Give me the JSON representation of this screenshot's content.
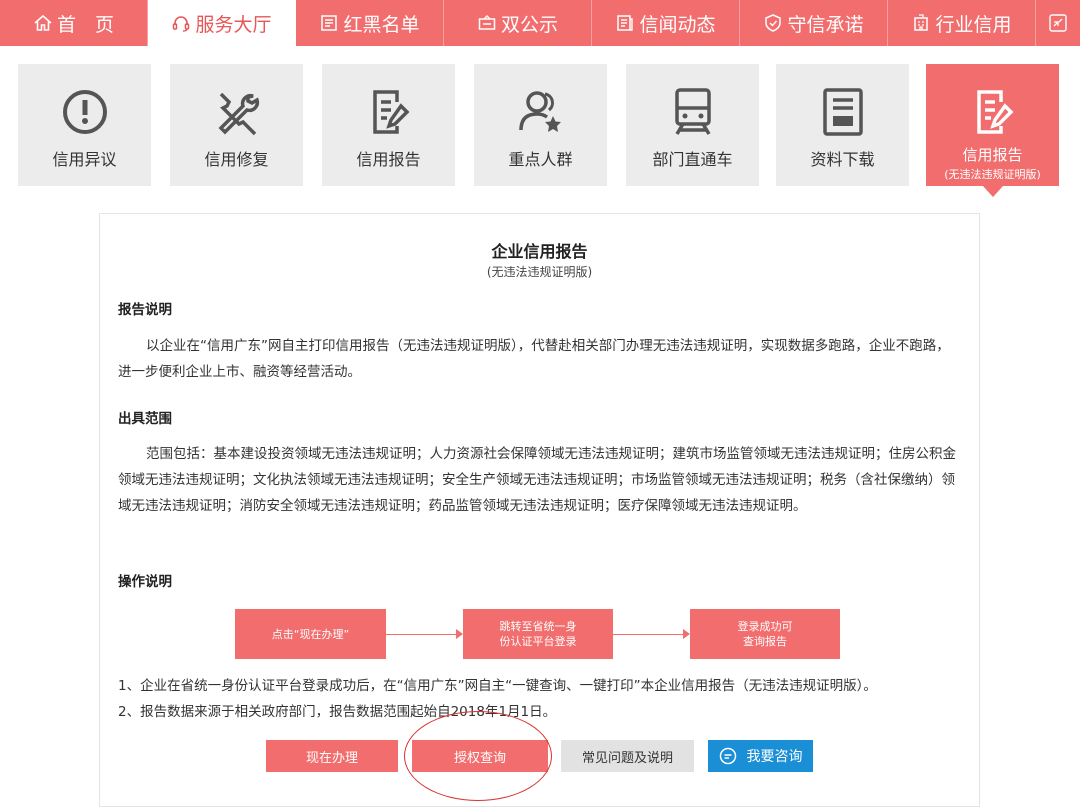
{
  "topnav": {
    "tabs": [
      {
        "label": "首　页",
        "icon": "home-icon"
      },
      {
        "label": "服务大厅",
        "icon": "headset-icon",
        "active": true
      },
      {
        "label": "红黑名单",
        "icon": "list-icon"
      },
      {
        "label": "双公示",
        "icon": "display-icon"
      },
      {
        "label": "信闻动态",
        "icon": "news-icon"
      },
      {
        "label": "守信承诺",
        "icon": "shield-icon"
      },
      {
        "label": "行业信用",
        "icon": "building-icon"
      }
    ],
    "collapse_icon": "collapse-icon"
  },
  "tiles": [
    {
      "label": "信用异议",
      "icon": "exclamation-circle-icon"
    },
    {
      "label": "信用修复",
      "icon": "tools-icon"
    },
    {
      "label": "信用报告",
      "icon": "report-icon"
    },
    {
      "label": "重点人群",
      "icon": "user-star-icon"
    },
    {
      "label": "部门直通车",
      "icon": "train-icon"
    },
    {
      "label": "资料下载",
      "icon": "download-doc-icon"
    },
    {
      "label": "信用报告",
      "sub": "(无违法违规证明版)",
      "icon": "report-icon",
      "active": true
    }
  ],
  "content": {
    "title": "企业信用报告",
    "subtitle": "(无违法违规证明版)",
    "sec1": "报告说明",
    "para1": "以企业在“信用广东”网自主打印信用报告（无违法违规证明版），代替赴相关部门办理无违法违规证明，实现数据多跑路，企业不跑路，进一步便利企业上市、融资等经营活动。",
    "sec2": "出具范围",
    "para2": "范围包括：基本建设投资领域无违法违规证明；人力资源社会保障领域无违法违规证明；建筑市场监管领域无违法违规证明；住房公积金领域无违法违规证明；文化执法领域无违法违规证明；安全生产领域无违法违规证明；市场监管领域无违法违规证明；税务（含社保缴纳）领域无违法违规证明；消防安全领域无违法违规证明；药品监管领域无违法违规证明；医疗保障领域无违法违规证明。",
    "sec3": "操作说明",
    "flow": {
      "step1": "点击“现在办理”",
      "step2a": "跳转至省统一身",
      "step2b": "份认证平台登录",
      "step3a": "登录成功可",
      "step3b": "查询报告"
    },
    "note1": "1、企业在省统一身份认证平台登录成功后，在“信用广东”网自主“一键查询、一键打印”本企业信用报告（无违法违规证明版）。",
    "note2": "2、报告数据来源于相关政府部门，报告数据范围起始自2018年1月1日。"
  },
  "buttons": {
    "apply": "现在办理",
    "authorize": "授权查询",
    "faq": "常见问题及说明",
    "consult": "我要咨询"
  },
  "colors": {
    "accent": "#f26d6d",
    "blue": "#1a8fd6",
    "ring": "#d9322f"
  }
}
